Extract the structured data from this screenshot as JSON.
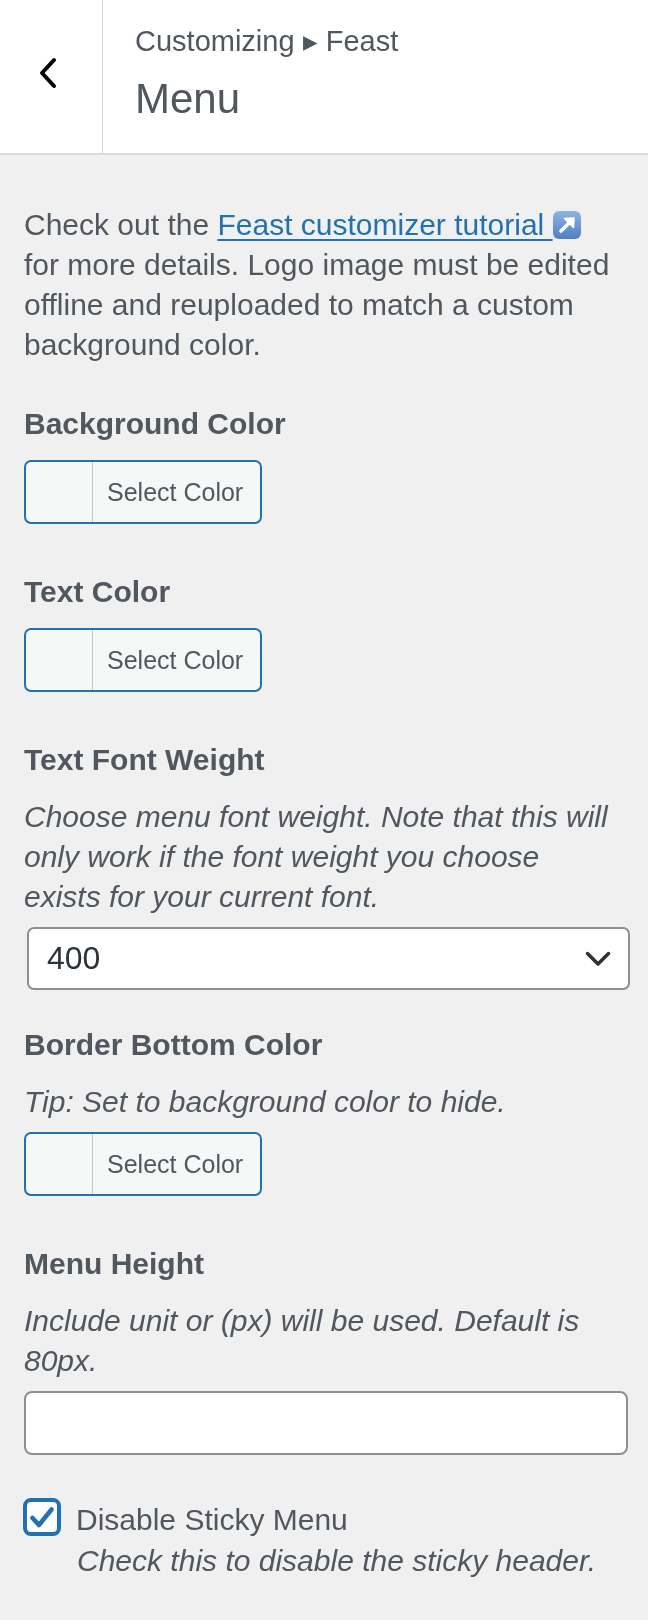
{
  "header": {
    "breadcrumb": "Customizing ▸ Feast",
    "title": "Menu"
  },
  "intro": {
    "before": "Check out the",
    "link": "Feast customizer tutorial",
    "after": "for more details. Logo image must be edited offline and reuploaded to match a custom background color."
  },
  "controls": [
    {
      "kind": "color",
      "label": "Background Color",
      "button": "Select Color"
    },
    {
      "kind": "color",
      "label": "Text Color",
      "button": "Select Color"
    },
    {
      "kind": "select",
      "label": "Text Font Weight",
      "description": "Choose menu font weight. Note that this will only work if the font weight you choose exists for your current font.",
      "value": "400"
    },
    {
      "kind": "color",
      "label": "Border Bottom Color",
      "description": "Tip: Set to background color to hide.",
      "button": "Select Color"
    },
    {
      "kind": "text",
      "label": "Menu Height",
      "description": "Include unit or (px) will be used. Default is 80px."
    },
    {
      "kind": "checkbox",
      "label": "Disable Sticky Menu",
      "description": "Check this to disable the sticky header.",
      "checked": true
    }
  ]
}
